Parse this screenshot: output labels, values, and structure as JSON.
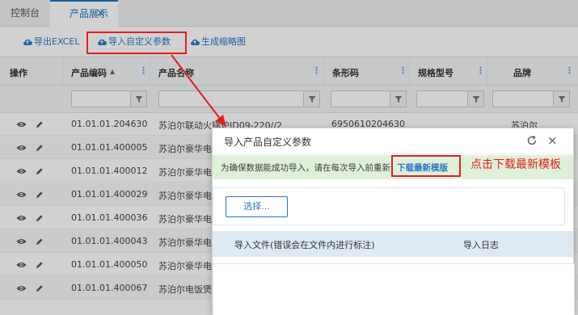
{
  "tabs": [
    {
      "label": "控制台"
    },
    {
      "label": "产品展示",
      "close": "×"
    }
  ],
  "toolbar": {
    "export_label": "导出EXCEL",
    "import_label": "导入自定义参数",
    "thumbnail_label": "生成缩略图"
  },
  "table": {
    "headers": {
      "ops": "操作",
      "code": "产品编码",
      "name": "产品名称",
      "barcode": "条形码",
      "spec": "规格型号",
      "brand": "品牌"
    },
    "sort_indicator": "▲",
    "rows": [
      {
        "code": "01.01.01.204630",
        "name": "苏泊尔联动火锅炉ID09-220//2",
        "barcode": "6950610204630",
        "brand": "苏泊尔"
      },
      {
        "code": "01.01.01.400005",
        "name": "苏泊尔豪华电"
      },
      {
        "code": "01.01.01.400012",
        "name": "苏泊尔豪华电"
      },
      {
        "code": "01.01.01.400029",
        "name": "苏泊尔豪华电"
      },
      {
        "code": "01.01.01.400036",
        "name": "苏泊尔豪华电"
      },
      {
        "code": "01.01.01.400043",
        "name": "苏泊尔豪华电"
      },
      {
        "code": "01.01.01.400050",
        "name": "苏泊尔豪华电"
      },
      {
        "code": "01.01.01.400067",
        "name": "苏泊尔电饭煲"
      }
    ]
  },
  "modal": {
    "title": "导入产品自定义参数",
    "close": "×",
    "notice": "为确保数据能成功导入，请在每次导入前重新",
    "download_link": "下载最新模版",
    "choose_button": "选择...",
    "grid_headers": {
      "file": "导入文件(错误会在文件内进行标注)",
      "log": "导入日志"
    }
  },
  "annotation": {
    "text": "点击下载最新模板"
  },
  "colors": {
    "accent": "#2b77c6",
    "annotation": "#e02020",
    "notice_bg": "#dff0d8"
  }
}
